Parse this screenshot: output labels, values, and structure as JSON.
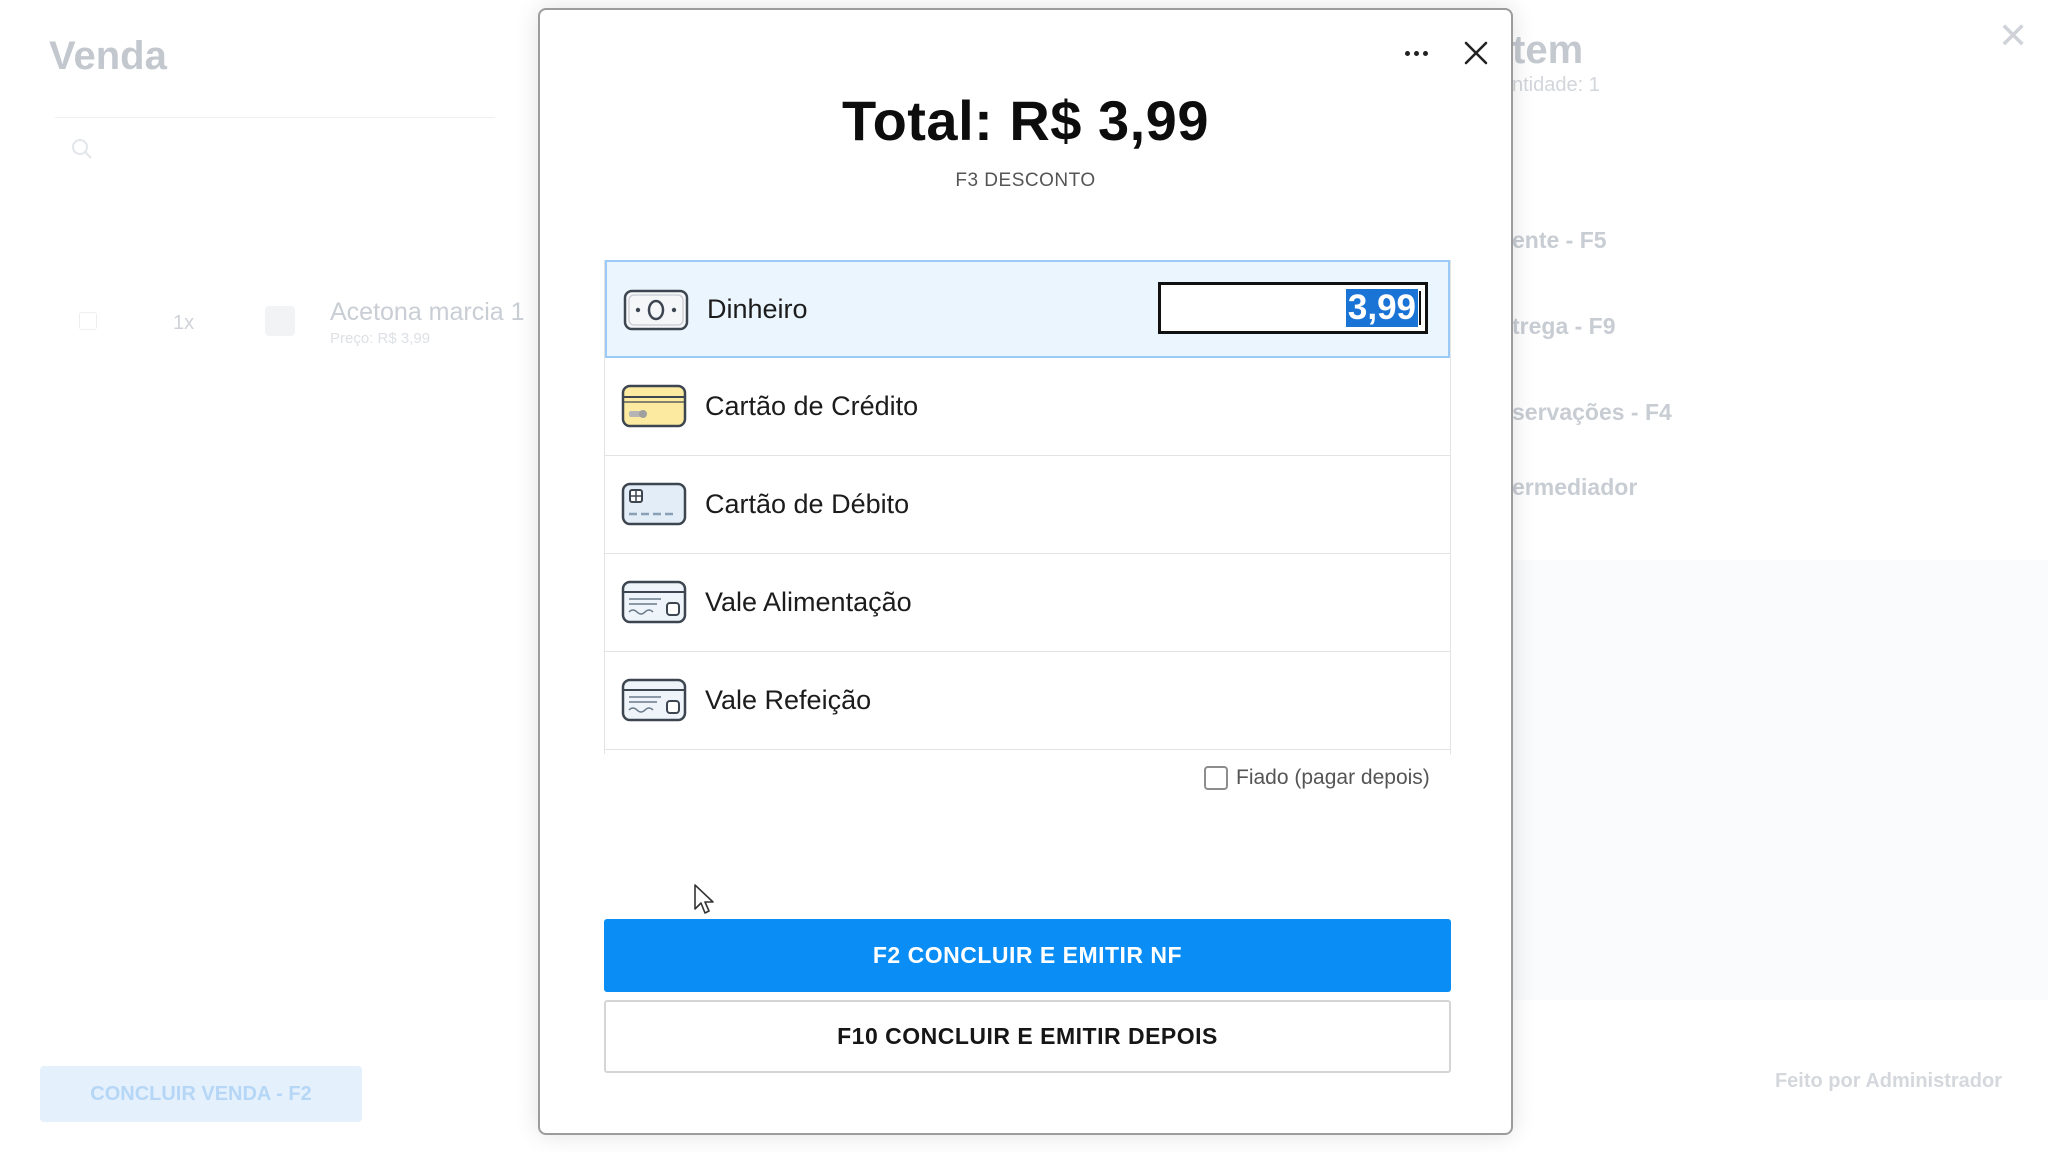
{
  "background": {
    "title": "Venda",
    "item": {
      "qty": "1x",
      "name": "Acetona marcia 1",
      "price": "Preço: R$ 3,99"
    },
    "finish_button": "CONCLUIR VENDA - F2",
    "right_title": "tem",
    "right_subtitle": "ntidade: 1",
    "right_items": [
      "ente - F5",
      "trega - F9",
      "servações - F4",
      "ermediador"
    ],
    "footer": "Feito por Administrador"
  },
  "modal": {
    "total_label": "Total: R$ 3,99",
    "discount_label": "F3 DESCONTO",
    "payment_methods": [
      {
        "label": "Dinheiro",
        "icon": "cash-icon",
        "selected": true,
        "amount": "3,99"
      },
      {
        "label": "Cartão de Crédito",
        "icon": "credit-card-icon",
        "selected": false
      },
      {
        "label": "Cartão de Débito",
        "icon": "debit-card-icon",
        "selected": false
      },
      {
        "label": "Vale Alimentação",
        "icon": "meal-voucher-icon",
        "selected": false
      },
      {
        "label": "Vale Refeição",
        "icon": "meal-voucher-icon",
        "selected": false
      }
    ],
    "fiado_label": "Fiado (pagar depois)",
    "fiado_checked": false,
    "primary_button": "F2 CONCLUIR E EMITIR NF",
    "secondary_button": "F10 CONCLUIR E EMITIR DEPOIS"
  },
  "colors": {
    "primary": "#0a8ef5",
    "selected_row_bg": "#ebf5fe",
    "selected_row_border": "#9ccaf7",
    "selection_highlight": "#1a74d6"
  }
}
